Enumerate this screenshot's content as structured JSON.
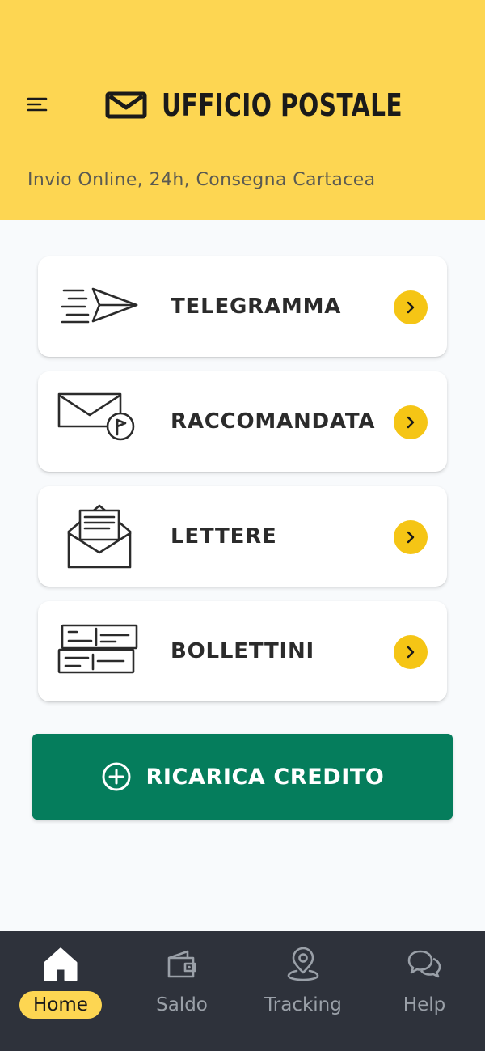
{
  "header": {
    "brand": "UFFICIO POSTALE",
    "subtitle": "Invio Online, 24h, Consegna Cartacea",
    "menu_icon": "menu-icon",
    "logo_icon": "envelope-logo-icon",
    "background_color": "#fdd652"
  },
  "services": [
    {
      "label": "TELEGRAMMA",
      "icon": "telegram-send-icon"
    },
    {
      "label": "RACCOMANDATA",
      "icon": "registered-mail-icon"
    },
    {
      "label": "LETTERE",
      "icon": "open-letter-icon"
    },
    {
      "label": "BOLLETTINI",
      "icon": "payment-slip-icon"
    }
  ],
  "cta": {
    "label": "RICARICA CREDITO",
    "icon": "plus-circle-icon",
    "color": "#057d5c"
  },
  "accent_color": "#f5c515",
  "bottom_nav": {
    "active": "Home",
    "items": [
      {
        "label": "Home",
        "icon": "home-icon"
      },
      {
        "label": "Saldo",
        "icon": "wallet-icon"
      },
      {
        "label": "Tracking",
        "icon": "location-pin-icon"
      },
      {
        "label": "Help",
        "icon": "chat-bubbles-icon"
      }
    ]
  }
}
